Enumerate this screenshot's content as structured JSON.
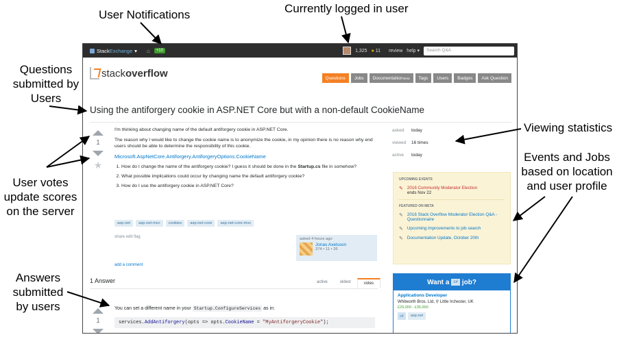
{
  "annotations": {
    "notifications": "User Notifications",
    "logged_in": "Currently logged in user",
    "questions": "Questions submitted by Users",
    "viewing": "Viewing statistics",
    "events_jobs": "Events and Jobs based on location and user profile",
    "votes": "User votes update scores on the server",
    "answers": "Answers submitted by users"
  },
  "topbar": {
    "brand_a": "Stack",
    "brand_b": "Exchange",
    "brand_caret": "▾",
    "rep_change": "+10",
    "reputation": "1,325",
    "bronze": "11",
    "review": "review",
    "help": "help ▾",
    "search_placeholder": "Search Q&A"
  },
  "logo": {
    "a": "stack",
    "b": "overflow"
  },
  "nav": {
    "questions": "Questions",
    "jobs": "Jobs",
    "documentation": "Documentation",
    "beta": "Beta",
    "tags": "Tags",
    "users": "Users",
    "badges": "Badges",
    "ask": "Ask Question"
  },
  "question": {
    "title": "Using the antiforgery cookie in ASP.NET Core but with a non-default CookieName",
    "votes": "1",
    "p1": "I'm thinking about changing name of the default antiforgery cookie in ASP.NET Core.",
    "p2": "The reason why I would like to change the cookie name is to anonymize the cookie, in my opinion there is no reason why end users should be able to determine the responsibility of this cookie.",
    "link": "Microsoft.AspNetCore.Antiforgery.AntiforgeryOptions.CookieName",
    "li1a": "How do I change the name of the antiforgery cookie? I guess it should be done in the ",
    "li1b": "Startup.cs",
    "li1c": " file in somehow?",
    "li2": "What possible implications could occur by changing name the default antiforgery cookie?",
    "li3": "How do I use the antiforgery cookie in ASP.NET Core?",
    "tags": [
      "asp.net",
      "asp.net-mvc",
      "cookies",
      "asp.net-core",
      "asp.net-core-mvc"
    ],
    "menu": "share  edit  flag",
    "asked": "asked 4 hours ago",
    "owner_name": "Jonas Axelsson",
    "owner_rep": "374 • 11 • 26",
    "add_comment": "add a comment"
  },
  "stats": {
    "asked_lbl": "asked",
    "asked_val": "today",
    "viewed_lbl": "viewed",
    "viewed_val": "16 times",
    "active_lbl": "active",
    "active_val": "today"
  },
  "events": {
    "head1": "UPCOMING EVENTS",
    "e1": "2016 Community Moderator Election",
    "e1_sub": "ends Nov 22",
    "head2": "FEATURED ON META",
    "m1": "2016 Stack Overflow Moderator Election Q&A - Questionnaire",
    "m2": "Upcoming improvements to job search",
    "m3": "Documentation Update, October 20th"
  },
  "jobs": {
    "head_a": "Want a",
    "head_tag": "c#",
    "head_b": "job?",
    "title": "Applications Developer",
    "company": "Whitworth Bros. Ltd,  ⚲ Little Irchester, UK",
    "salary": "£29,000 - £35,000",
    "logo": "c#",
    "tag": "asp.net"
  },
  "answers": {
    "header": "1 Answer",
    "sort_active": "active",
    "sort_oldest": "oldest",
    "sort_votes": "votes",
    "votes": "1",
    "text_a": "You can set a different name in your ",
    "text_code": "Startup.ConfigureServices",
    "text_b": " as in:",
    "code_a": "services.",
    "code_k1": "AddAntiforgery",
    "code_b": "(opts => opts.",
    "code_k2": "CookieName",
    "code_c": " = ",
    "code_s": "\"MyAntiforgeryCookie\"",
    "code_d": ");"
  }
}
